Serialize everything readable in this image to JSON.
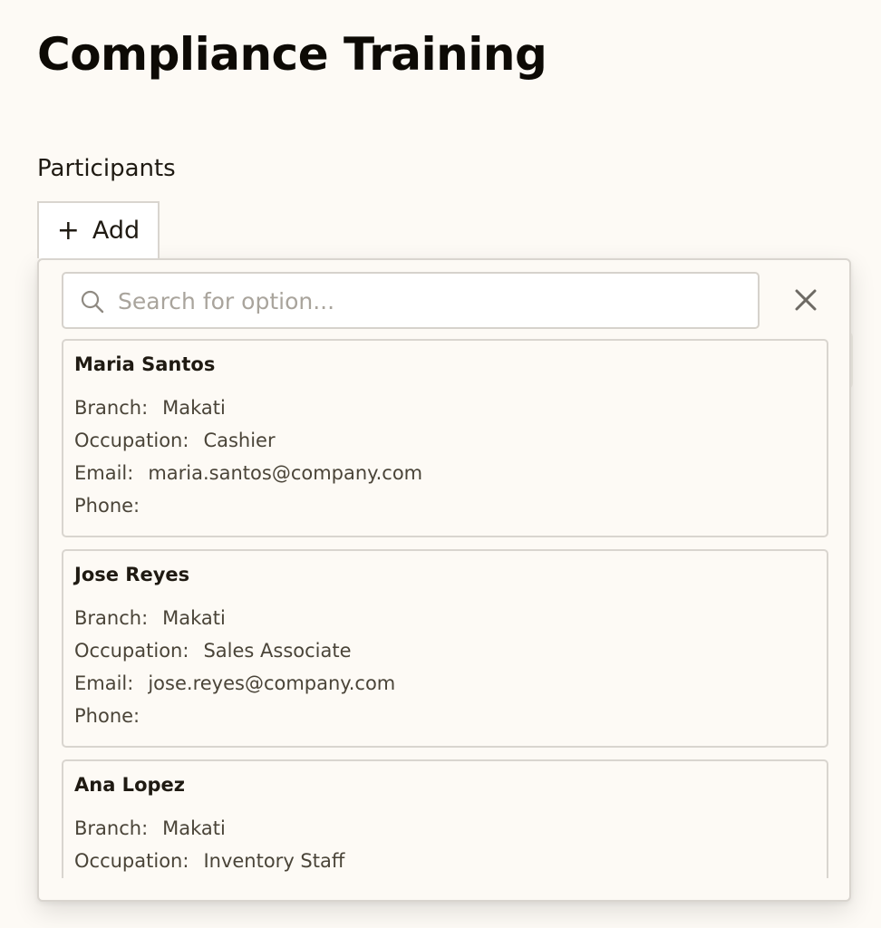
{
  "page": {
    "title": "Compliance Training"
  },
  "participants": {
    "label": "Participants",
    "add_button": {
      "icon": "plus-icon",
      "icon_glyph": "+",
      "label": "Add"
    }
  },
  "picker": {
    "search": {
      "placeholder": "Search for option...",
      "value": "",
      "icon": "search-icon"
    },
    "close_icon": "close-icon",
    "field_labels": {
      "branch": "Branch:",
      "occupation": "Occupation:",
      "email": "Email:",
      "phone": "Phone:"
    },
    "options": [
      {
        "name": "Maria Santos",
        "branch": "Makati",
        "occupation": "Cashier",
        "email": "maria.santos@company.com",
        "phone": ""
      },
      {
        "name": "Jose Reyes",
        "branch": "Makati",
        "occupation": "Sales Associate",
        "email": "jose.reyes@company.com",
        "phone": ""
      },
      {
        "name": "Ana Lopez",
        "branch": "Makati",
        "occupation": "Inventory Staff",
        "email": "",
        "phone": ""
      }
    ]
  },
  "colors": {
    "background": "#fdfaf5",
    "border": "#d9d5cf",
    "text": "#1f1a12",
    "muted_text": "#4a4438",
    "placeholder": "#a9a49c"
  }
}
